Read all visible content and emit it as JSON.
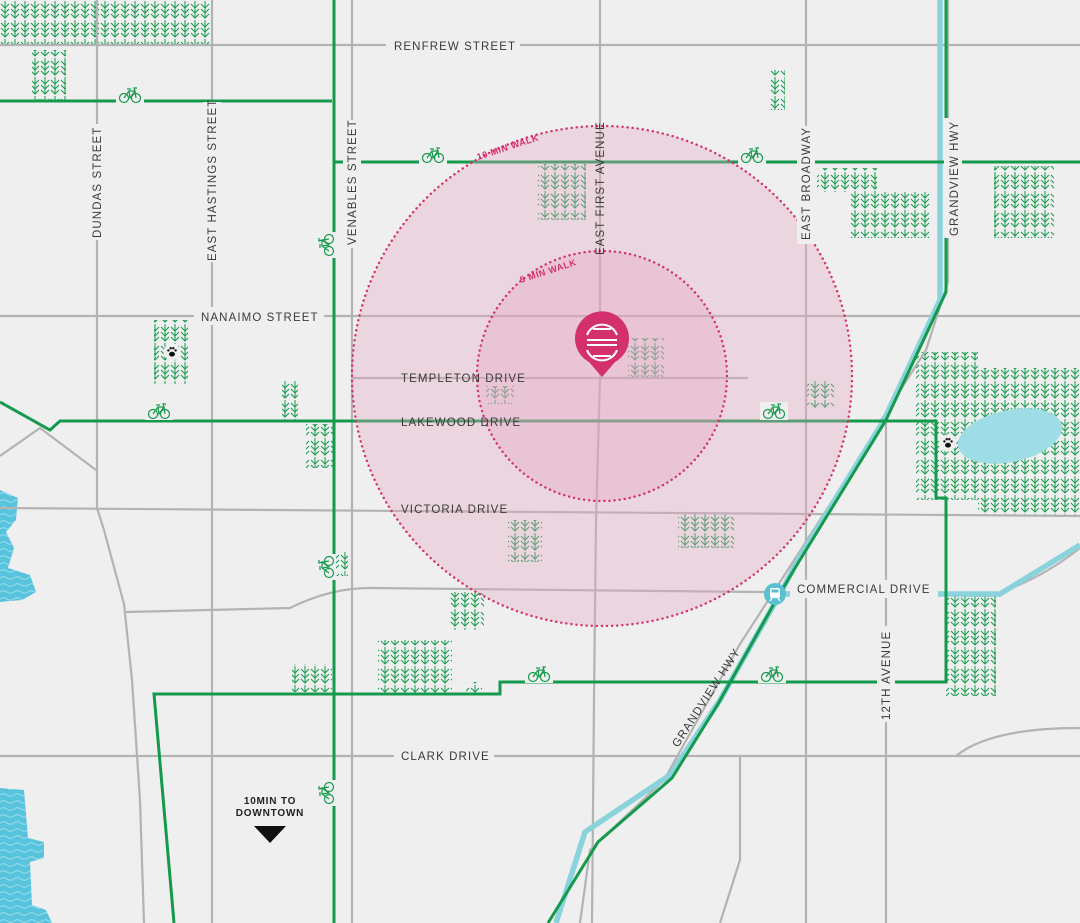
{
  "streets": {
    "renfrew": "RENFREW STREET",
    "dundas": "DUNDAS STREET",
    "east_hastings": "EAST HASTINGS STREET",
    "venables": "VENABLES STREET",
    "nanaimo": "NANAIMO STREET",
    "templeton": "TEMPLETON DRIVE",
    "lakewood": "LAKEWOOD DRIVE",
    "victoria": "VICTORIA DRIVE",
    "commercial": "COMMERCIAL DRIVE",
    "clark": "CLARK DRIVE",
    "east_first": "EAST FIRST AVENUE",
    "east_broadway": "EAST BROADWAY",
    "grandview_hwy_north": "GRANDVIEW HWY",
    "grandview_hwy_diag": "GRANDVIEW HWY",
    "twelfth": "12TH AVENUE"
  },
  "walk": {
    "ten": "10 MIN WALK",
    "five": "5 MIN WALK"
  },
  "downtown": {
    "line1": "10MIN TO",
    "line2": "DOWNTOWN"
  },
  "icons": {
    "location_pin": "location-pin-icon",
    "bike": "bike-icon",
    "dog_park": "paw-icon",
    "transit": "transit-station-icon"
  },
  "colors": {
    "background": "#efefef",
    "road": "#b3b3b3",
    "bike_route": "#149a4c",
    "transit_line": "#8ad3dc",
    "water": "#58c3dc",
    "walk_radius": "#d4306e",
    "pin": "#d4306e"
  }
}
